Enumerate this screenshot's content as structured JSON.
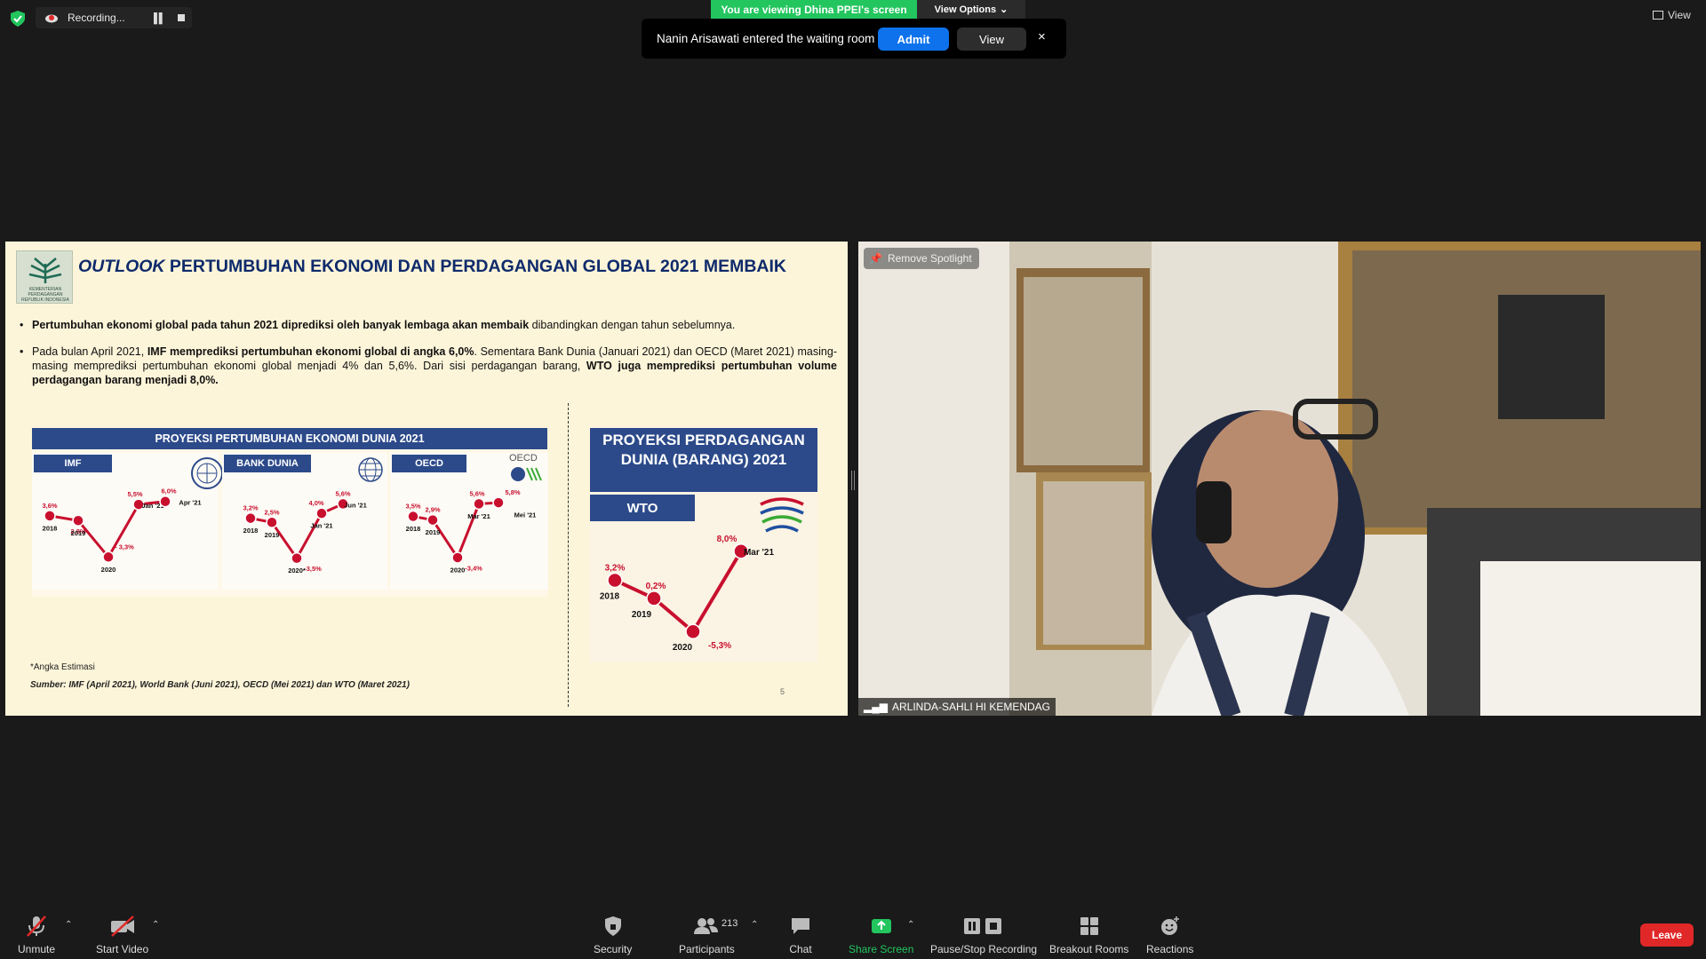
{
  "recording": {
    "label": "Recording..."
  },
  "banner": {
    "viewing": "You are viewing Dhina PPEI's screen",
    "view_options": "View Options"
  },
  "top_right": {
    "view_label": "View"
  },
  "waiting_room": {
    "message": "Nanin Arisawati entered the waiting room",
    "admit": "Admit",
    "view": "View",
    "close": "×"
  },
  "slide": {
    "logo_text": "KEMENTERIAN PERDAGANGAN REPUBLIK INDONESIA",
    "title_italic": "OUTLOOK",
    "title_rest": " PERTUMBUHAN EKONOMI DAN PERDAGANGAN GLOBAL 2021 MEMBAIK",
    "bullet_mark": "•",
    "bullet1_bold": "Pertumbuhan ekonomi global pada tahun 2021 diprediksi oleh banyak lembaga akan membaik",
    "bullet1_rest": " dibandingkan dengan tahun sebelumnya.",
    "bullet2_a": "Pada bulan April 2021, ",
    "bullet2_b": "IMF memprediksi pertumbuhan ekonomi global di angka 6,0%",
    "bullet2_c": ". Sementara Bank Dunia (Januari 2021) dan OECD (Maret 2021) masing-masing memprediksi pertumbuhan ekonomi global menjadi 4% dan 5,6%. Dari sisi perdagangan barang, ",
    "bullet2_d": "WTO juga memprediksi pertumbuhan volume perdagangan barang menjadi 8,0%.",
    "proj_header": "PROYEKSI PERTUMBUHAN EKONOMI DUNIA 2021",
    "wto_header": "PROYEKSI PERDAGANGAN DUNIA (BARANG) 2021",
    "wto_tab": "WTO",
    "note": "*Angka Estimasi",
    "source": "Sumber: IMF (April 2021), World Bank (Juni 2021), OECD (Mei 2021) dan WTO (Maret 2021)",
    "page": "5"
  },
  "chart_data": [
    {
      "type": "line",
      "title": "IMF",
      "x": [
        "2018",
        "2019",
        "2020",
        "Jan '21",
        "Apr '21"
      ],
      "values": [
        3.6,
        2.8,
        -3.3,
        5.5,
        6.0
      ],
      "labels": [
        "3,6%",
        "2,8%",
        "- 3,3%",
        "5,5%",
        "6,0%"
      ]
    },
    {
      "type": "line",
      "title": "BANK DUNIA",
      "x": [
        "2018",
        "2019",
        "2020*",
        "Jan '21",
        "Jun '21"
      ],
      "values": [
        3.2,
        2.5,
        -3.5,
        4.0,
        5.6
      ],
      "labels": [
        "3,2%",
        "2,5%",
        "-3,5%",
        "4,0%",
        "5,6%"
      ]
    },
    {
      "type": "line",
      "title": "OECD",
      "x": [
        "2018",
        "2019",
        "2020",
        "Mar '21",
        "Mei '21"
      ],
      "values": [
        3.5,
        2.9,
        -3.4,
        5.6,
        5.8
      ],
      "labels": [
        "3,5%",
        "2,9%",
        "-3,4%",
        "5,6%",
        "5,8%"
      ],
      "logo_text": "OECD"
    },
    {
      "type": "line",
      "title": "WTO",
      "x": [
        "2018",
        "2019",
        "2020",
        "Mar '21"
      ],
      "values": [
        3.2,
        0.2,
        -5.3,
        8.0
      ],
      "labels": [
        "3,2%",
        "0,2%",
        "-5,3%",
        "8,0%"
      ]
    }
  ],
  "video": {
    "remove_spotlight": "Remove Spotlight",
    "participant_name": "ARLINDA-SAHLI HI KEMENDAG"
  },
  "toolbar": {
    "unmute": "Unmute",
    "start_video": "Start Video",
    "security": "Security",
    "participants": "Participants",
    "participant_count": "213",
    "chat": "Chat",
    "share_screen": "Share Screen",
    "pause_stop": "Pause/Stop Recording",
    "breakout": "Breakout Rooms",
    "reactions": "Reactions",
    "leave": "Leave"
  },
  "colors": {
    "admit": "#0e72ed",
    "banner": "#22c55e",
    "leave": "#e02828",
    "chart_line": "#c8102e",
    "slide_blue": "#2c4a8a"
  }
}
